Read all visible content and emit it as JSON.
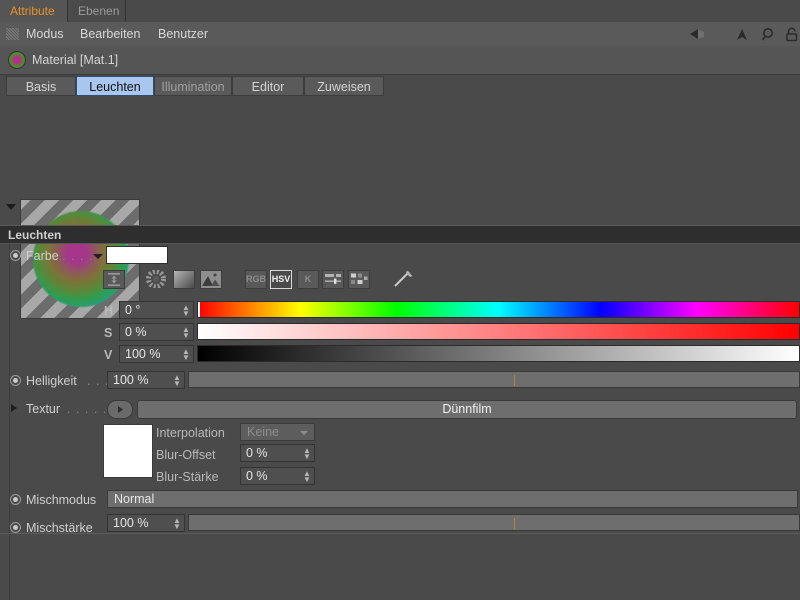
{
  "window": {
    "tabs": [
      {
        "label": "Attribute",
        "selected": true
      },
      {
        "label": "Ebenen",
        "selected": false
      }
    ]
  },
  "menubar": {
    "grip_icon": "grip-dots-icon",
    "items": [
      "Modus",
      "Bearbeiten",
      "Benutzer"
    ],
    "tools": [
      {
        "name": "back-arrow-icon",
        "glyph": "◀"
      },
      {
        "name": "up-arrow-icon",
        "glyph": "▲"
      },
      {
        "name": "search-icon",
        "glyph": "⚲"
      },
      {
        "name": "lock-icon",
        "glyph": "🔒"
      }
    ]
  },
  "object": {
    "icon": "material-sphere-icon",
    "title": "Material [Mat.1]"
  },
  "page_tabs": [
    {
      "label": "Basis",
      "state": "normal"
    },
    {
      "label": "Leuchten",
      "state": "selected"
    },
    {
      "label": "Illumination",
      "state": "dim"
    },
    {
      "label": "Editor",
      "state": "normal"
    },
    {
      "label": "Zuweisen",
      "state": "normal"
    }
  ],
  "preview": {
    "name": "material-preview",
    "collapse_icon": "triangle-down-icon"
  },
  "section": {
    "title": "Leuchten"
  },
  "color": {
    "label": "Farbe",
    "dots": ". . . .",
    "swatch_hex": "#ffffff",
    "mode_icons": [
      {
        "name": "expand-vertical-icon",
        "text": ""
      },
      {
        "name": "color-wheel-icon",
        "text": ""
      },
      {
        "name": "gradient-box-icon",
        "text": ""
      },
      {
        "name": "image-picker-icon",
        "text": ""
      }
    ],
    "model_buttons": [
      {
        "name": "rgb-button",
        "text": "RGB",
        "selected": false
      },
      {
        "name": "hsv-button",
        "text": "HSV",
        "selected": true
      },
      {
        "name": "k-button",
        "text": "K",
        "selected": false
      },
      {
        "name": "sliders-button",
        "text": "",
        "selected": false
      },
      {
        "name": "swatches-button",
        "text": "",
        "selected": false
      }
    ],
    "eyedropper_icon": "eyedropper-icon",
    "channels": [
      {
        "key": "H",
        "value": "0 °",
        "handle_pct": 0
      },
      {
        "key": "S",
        "value": "0 %",
        "handle_pct": 0
      },
      {
        "key": "V",
        "value": "100 %",
        "handle_pct": 100
      }
    ]
  },
  "brightness": {
    "label": "Helligkeit",
    "dots": ". . .",
    "value": "100 %"
  },
  "texture": {
    "label": "Textur",
    "dots": ". . . . . .",
    "expand_icon": "triangle-right-icon",
    "browse_icon": "triangle-right-small-icon",
    "shader_name": "Dünnfilm",
    "thumbnail_hex": "#ffffff",
    "interpolation_label": "Interpolation",
    "interpolation_value": "Keine",
    "blur_offset_label": "Blur-Offset",
    "blur_offset_value": "0 %",
    "blur_strength_label": "Blur-Stärke",
    "blur_strength_value": "0 %"
  },
  "mix": {
    "mode_label": "Mischmodus",
    "mode_value": "Normal",
    "strength_label": "Mischstärke",
    "strength_value": "100 %"
  }
}
